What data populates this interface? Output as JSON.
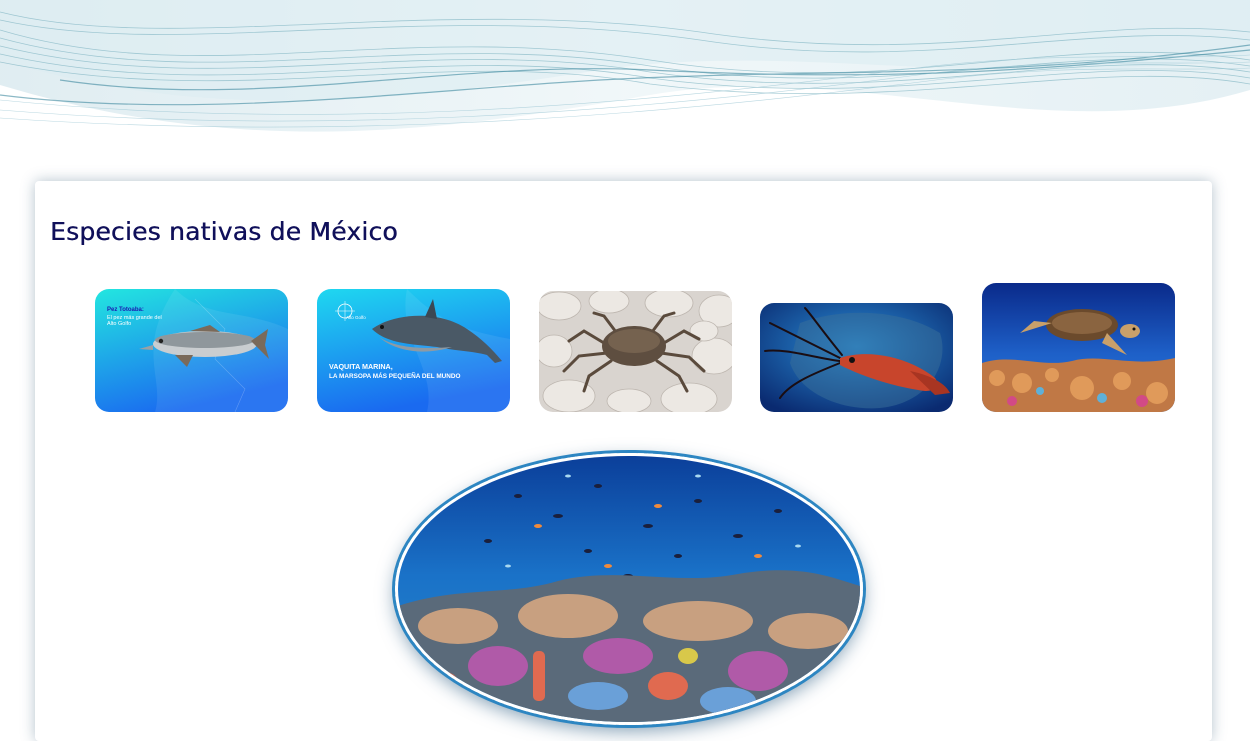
{
  "section": {
    "title": "Especies nativas de México"
  },
  "thumbnails": [
    {
      "name": "Pez Totoaba",
      "caption_title": "Pez Totoaba:",
      "caption_sub": "El pez más grande del Alto Golfo"
    },
    {
      "name": "Vaquita marina",
      "caption_line1": "VAQUITA MARINA,",
      "caption_line2": "LA MARSOPA MÁS PEQUEÑA DEL MUNDO",
      "badge": "Alto Golfo"
    },
    {
      "name": "Cangrejo"
    },
    {
      "name": "Calamar"
    },
    {
      "name": "Tortuga marina"
    }
  ],
  "featured": {
    "name": "Arrecife de coral"
  },
  "colors": {
    "title": "#10105a",
    "thumb_gradient_top": "#23e6e0",
    "thumb_gradient_bottom": "#1a6bf0",
    "oval_border": "#2d86c2"
  }
}
